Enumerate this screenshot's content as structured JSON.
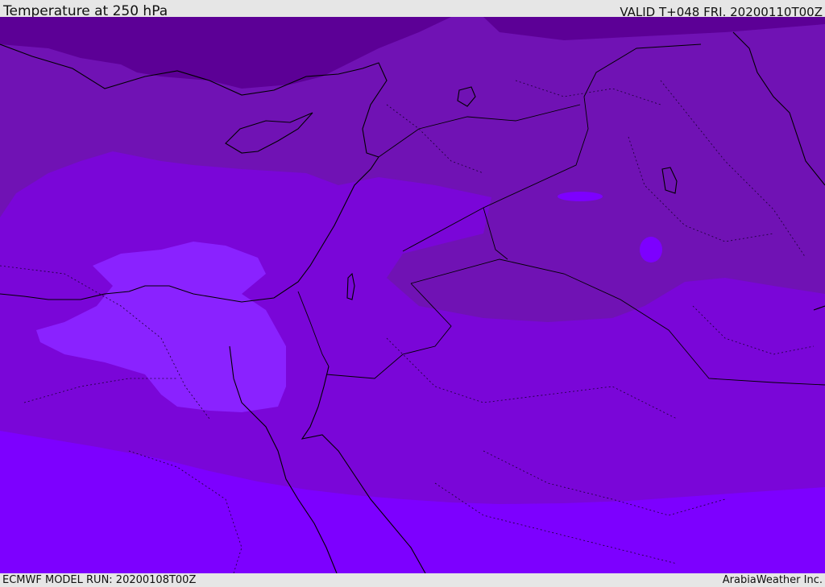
{
  "header": {
    "title": "Temperature at 250 hPa",
    "valid": "VALID T+048 FRI. 20200110T00Z"
  },
  "footer": {
    "model_run": "ECMWF MODEL RUN: 20200108T00Z",
    "credit": "ArabiaWeather Inc."
  },
  "map": {
    "field": "temperature",
    "level": "250 hPa",
    "colors": {
      "band_coldest": "#5c0096",
      "band_cold": "#7012b4",
      "band_mid": "#7a06d8",
      "band_warm": "#7d00ff",
      "band_warmest": "#8a22ff",
      "coastline": "#000000",
      "border": "#1a0033"
    }
  }
}
